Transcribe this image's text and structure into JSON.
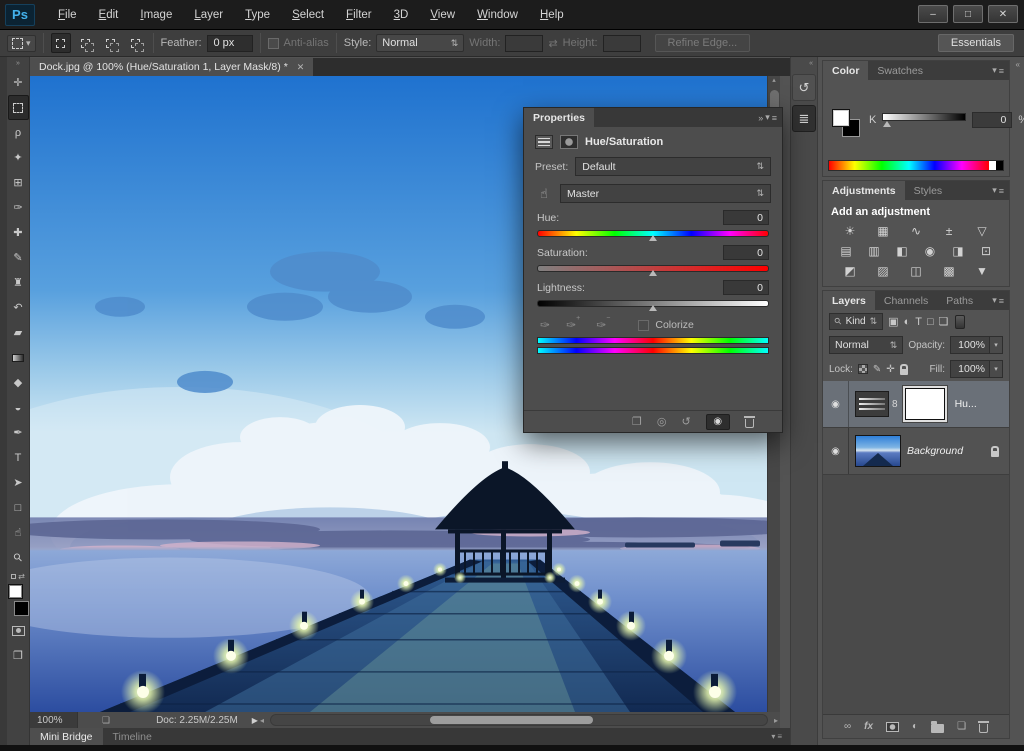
{
  "colors": {
    "titlebar_bg": "#1c1c1c",
    "panel_bg": "#535353",
    "dark_well": "#424242",
    "accent_blue": "#43b1ec",
    "selected_layer_bg": "#6a7078"
  },
  "icons": {
    "collapse_right": "»",
    "collapse_left": "«",
    "panel_menu": "≡",
    "menu_arrow": "▾",
    "dropdown_arrows": "⇅",
    "close": "✕",
    "eye": "◉",
    "search": "⚲",
    "link_chain": "8",
    "statusbar_flyout": "▶",
    "scroll_left": "◂",
    "scroll_right": "▸",
    "scroll_up": "▴",
    "scroll_down": "▾",
    "swap_arrows": "⇄",
    "window_minimize": "–",
    "window_maximize": "□",
    "window_close": "✕"
  },
  "titlebar": {
    "logo": "Ps",
    "menus": [
      "File",
      "Edit",
      "Image",
      "Layer",
      "Type",
      "Select",
      "Filter",
      "3D",
      "View",
      "Window",
      "Help"
    ]
  },
  "options_bar": {
    "feather_label": "Feather:",
    "feather_value": "0 px",
    "anti_alias_label": "Anti-alias",
    "style_label": "Style:",
    "style_value": "Normal",
    "width_label": "Width:",
    "height_label": "Height:",
    "refine_edge_label": "Refine Edge...",
    "workspace_label": "Essentials"
  },
  "toolbar": {
    "tools": [
      {
        "name": "move-tool",
        "glyph": "✛"
      },
      {
        "name": "rectangular-marquee-tool",
        "glyph": ""
      },
      {
        "name": "lasso-tool",
        "glyph": "ρ"
      },
      {
        "name": "quick-selection-tool",
        "glyph": "✦"
      },
      {
        "name": "crop-tool",
        "glyph": "⊞"
      },
      {
        "name": "eyedropper-tool",
        "glyph": "✑"
      },
      {
        "name": "healing-brush-tool",
        "glyph": "✚"
      },
      {
        "name": "brush-tool",
        "glyph": "✎"
      },
      {
        "name": "clone-stamp-tool",
        "glyph": "♜"
      },
      {
        "name": "history-brush-tool",
        "glyph": "↶"
      },
      {
        "name": "eraser-tool",
        "glyph": "▰"
      },
      {
        "name": "gradient-tool",
        "glyph": ""
      },
      {
        "name": "blur-tool",
        "glyph": "◆"
      },
      {
        "name": "dodge-tool",
        "glyph": "◒"
      },
      {
        "name": "pen-tool",
        "glyph": "✒"
      },
      {
        "name": "type-tool",
        "glyph": "T"
      },
      {
        "name": "path-selection-tool",
        "glyph": "➤"
      },
      {
        "name": "shape-tool",
        "glyph": "□"
      },
      {
        "name": "hand-tool",
        "glyph": "☝"
      },
      {
        "name": "zoom-tool",
        "glyph": "⚲"
      }
    ]
  },
  "document": {
    "tab_title": "Dock.jpg @ 100% (Hue/Saturation 1, Layer Mask/8) *",
    "status_zoom": "100%",
    "save_icon": "❏",
    "status_doc": "Doc: 2.25M/2.25M",
    "bottom_tabs": [
      "Mini Bridge",
      "Timeline"
    ]
  },
  "collapsed_dock": {
    "history_glyph": "↺",
    "properties_glyph": "≣"
  },
  "properties": {
    "tab": "Properties",
    "title": "Hue/Saturation",
    "preset_label": "Preset:",
    "preset_value": "Default",
    "channel_value": "Master",
    "tat_icon": "☝",
    "sliders": [
      {
        "label": "Hue:",
        "value": "0"
      },
      {
        "label": "Saturation:",
        "value": "0"
      },
      {
        "label": "Lightness:",
        "value": "0"
      }
    ],
    "droppers": [
      {
        "glyph": "✑",
        "mod": ""
      },
      {
        "glyph": "✑",
        "mod": "+"
      },
      {
        "glyph": "✑",
        "mod": "−"
      }
    ],
    "colorize_label": "Colorize",
    "footer": {
      "clip": "❐",
      "prev": "◎",
      "reset": "↺",
      "eye": "◉"
    }
  },
  "color_panel": {
    "tabs": [
      "Color",
      "Swatches"
    ],
    "k_label": "K",
    "k_value": "0",
    "percent": "%"
  },
  "adjustments": {
    "tabs": [
      "Adjustments",
      "Styles"
    ],
    "heading": "Add an adjustment",
    "row1": [
      {
        "name": "brightness-contrast",
        "glyph": "☀"
      },
      {
        "name": "levels",
        "glyph": "▦"
      },
      {
        "name": "curves",
        "glyph": "∿"
      },
      {
        "name": "exposure",
        "glyph": "±"
      },
      {
        "name": "vibrance",
        "glyph": "▽"
      }
    ],
    "row2": [
      {
        "name": "hue-saturation",
        "glyph": "▤"
      },
      {
        "name": "color-balance",
        "glyph": "▥"
      },
      {
        "name": "black-white",
        "glyph": "◧"
      },
      {
        "name": "photo-filter",
        "glyph": "◉"
      },
      {
        "name": "channel-mixer",
        "glyph": "◨"
      },
      {
        "name": "color-lookup",
        "glyph": "⊡"
      }
    ],
    "row3": [
      {
        "name": "invert",
        "glyph": "◩"
      },
      {
        "name": "posterize",
        "glyph": "▨"
      },
      {
        "name": "threshold",
        "glyph": "◫"
      },
      {
        "name": "gradient-map",
        "glyph": "▩"
      },
      {
        "name": "selective-color",
        "glyph": "▼"
      }
    ]
  },
  "layers": {
    "tabs": [
      "Layers",
      "Channels",
      "Paths"
    ],
    "kind_label": "Kind",
    "filters": [
      {
        "name": "filter-pixel-layers",
        "glyph": "▣"
      },
      {
        "name": "filter-adjustment-layers",
        "glyph": "◐"
      },
      {
        "name": "filter-type-layers",
        "glyph": "T"
      },
      {
        "name": "filter-shape-layers",
        "glyph": "□"
      },
      {
        "name": "filter-smart-objects",
        "glyph": "❏"
      }
    ],
    "blend_mode": "Normal",
    "opacity_label": "Opacity:",
    "opacity_value": "100%",
    "lock_label": "Lock:",
    "lock_brush": "✎",
    "lock_move": "✛",
    "fill_label": "Fill:",
    "fill_value": "100%",
    "layer_adjustment_name": "Hu...",
    "layer_background_name": "Background",
    "footer": {
      "link": "∞",
      "fx": "fx",
      "adjustment": "◐",
      "new_layer": "❏"
    }
  }
}
